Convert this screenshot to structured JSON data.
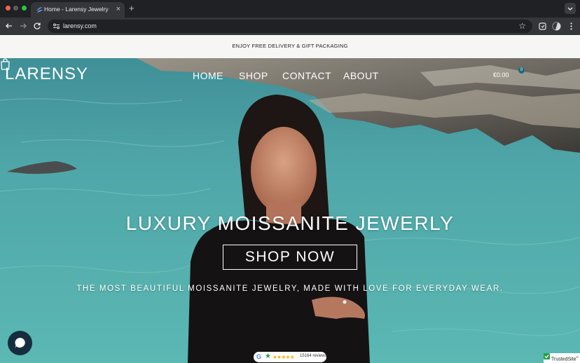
{
  "browser": {
    "tab_title": "Home - Larensy Jewelry",
    "tab_close": "×",
    "new_tab": "+",
    "url": "larensy.com",
    "bookmark_star": "☆"
  },
  "announcement": {
    "text": "ENJOY FREE DELIVERY & GIFT PACKAGING"
  },
  "header": {
    "logo": "LARENSY",
    "nav": [
      {
        "label": "HOME"
      },
      {
        "label": "SHOP"
      },
      {
        "label": "CONTACT"
      },
      {
        "label": "ABOUT"
      }
    ],
    "cart_total": "€0.00",
    "cart_count": "0"
  },
  "hero": {
    "headline": "LUXURY MOISSANITE JEWERLY",
    "cta_label": "SHOP NOW",
    "subline": "THE MOST BEAUTIFUL MOISSANITE JEWELRY, MADE WITH LOVE FOR EVERYDAY WEAR."
  },
  "reviews_badge": {
    "google_letter": "G",
    "green_star": "★",
    "stars": "★★★★★",
    "rating_fraction": 1.0,
    "count_text": "15164 reviews"
  },
  "trusted_badge": {
    "label": "TrustedSite",
    "mark": "®"
  },
  "colors": {
    "water": "#4aa9a9",
    "accent_badge": "#1c6b7e",
    "chat_button": "#162d3f",
    "announce_bg": "#f6f6f4"
  },
  "icons": [
    "back-arrow-icon",
    "forward-arrow-icon",
    "reload-icon",
    "site-info-icon",
    "bookmark-star-icon",
    "extension-icon",
    "profile-icon",
    "kebab-menu-icon",
    "cart-icon",
    "chat-icon",
    "google-icon",
    "trusted-check-icon"
  ]
}
